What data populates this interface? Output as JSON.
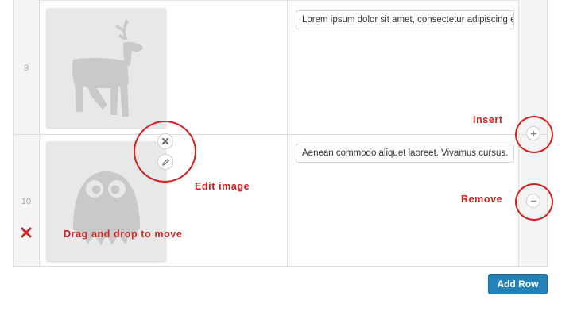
{
  "rows": [
    {
      "number": "9",
      "text_value": "Lorem ipsum dolor sit amet, consectetur adipiscing elit."
    },
    {
      "number": "10",
      "text_value": "Aenean commodo aliquet laoreet. Vivamus cursus."
    }
  ],
  "annotations": {
    "insert": "Insert",
    "edit_image": "Edit image",
    "remove": "Remove",
    "drag": "Drag and drop to move"
  },
  "buttons": {
    "add_row": "Add Row"
  },
  "icons": {
    "row9_thumbnail": "deer-icon",
    "row10_thumbnail": "ghost-icon",
    "remove_image": "close-icon",
    "edit_image": "pencil-icon",
    "insert_row": "plus-icon",
    "remove_row": "minus-icon",
    "delete_row": "x-icon"
  },
  "colors": {
    "annotation": "#d42020",
    "button": "#2382b8"
  }
}
